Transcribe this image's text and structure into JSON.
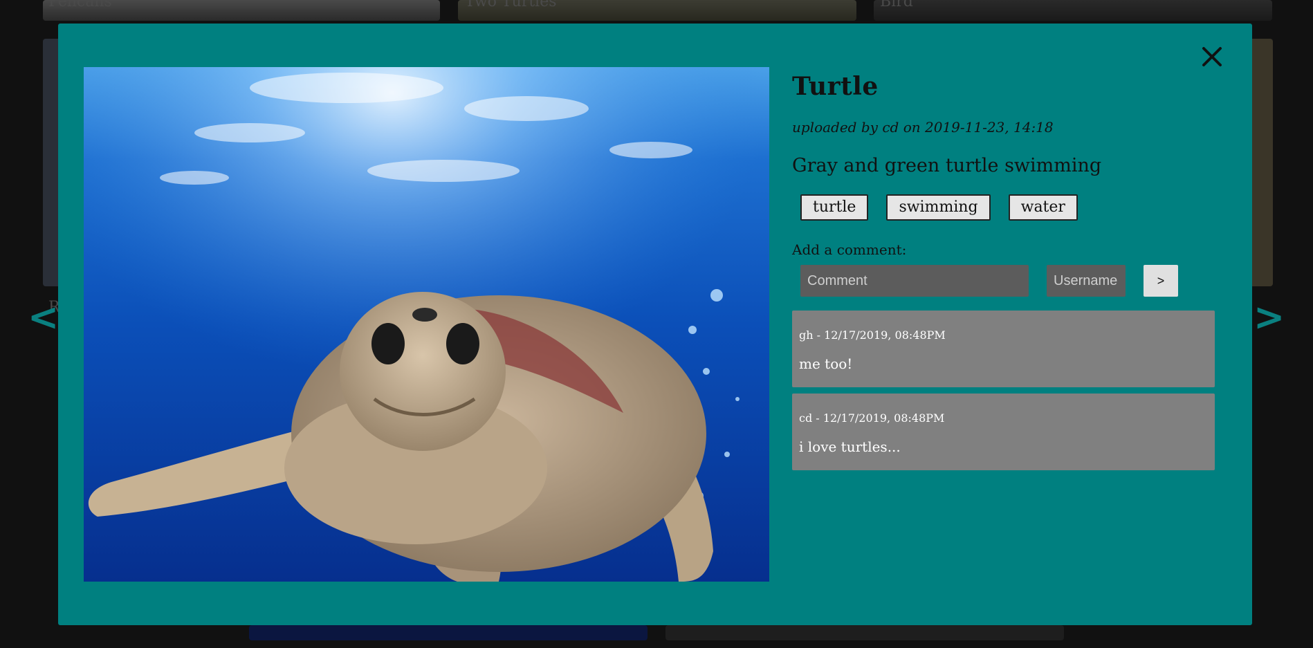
{
  "background": {
    "captions": [
      "Pelicans",
      "Two Turtles",
      "Bird"
    ],
    "partial_caption": "R",
    "nav_prev_label": "<",
    "nav_next_label": ">"
  },
  "modal": {
    "close_icon": "close-icon",
    "photo_alt": "Gray and green turtle swimming",
    "title": "Turtle",
    "meta_prefix": "uploaded by",
    "meta_user": "cd",
    "meta_on": "on",
    "meta_date": "2019-11-23, 14:18",
    "description": "Gray and green turtle swimming",
    "tags": [
      "turtle",
      "swimming",
      "water"
    ],
    "comment_label": "Add a comment:",
    "comment_placeholder": "Comment",
    "username_placeholder": "Username",
    "submit_label": ">",
    "comments": [
      {
        "author_time": "gh - 12/17/2019, 08:48PM",
        "text": "me too!"
      },
      {
        "author_time": "cd - 12/17/2019, 08:48PM",
        "text": "i love turtles..."
      }
    ]
  },
  "colors": {
    "modal_bg": "#008080",
    "page_bg": "#111111",
    "comment_bg": "#808080",
    "input_bg": "#5c5c5c",
    "accent": "#0a8080"
  }
}
